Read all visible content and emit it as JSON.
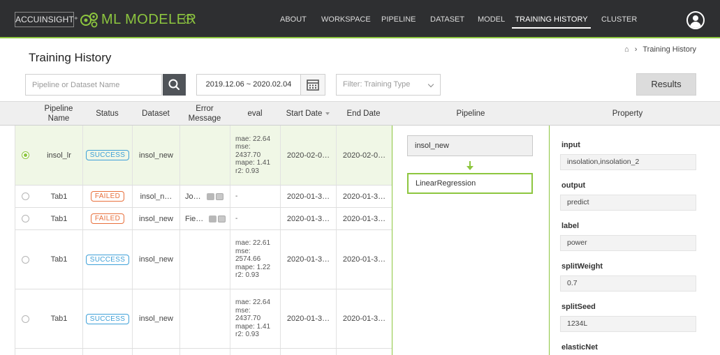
{
  "nav": {
    "brand": "ACCUINSIGHT⁺",
    "product": "ML MODELER",
    "items": [
      "ABOUT",
      "WORKSPACE",
      "PIPELINE",
      "DATASET",
      "MODEL",
      "TRAINING HISTORY",
      "CLUSTER"
    ],
    "active": "TRAINING HISTORY",
    "accent_color": "#8dc63f"
  },
  "page": {
    "title": "Training History",
    "breadcrumb": "Training History"
  },
  "filters": {
    "search_placeholder": "Pipeline or Dataset Name",
    "date_range": "2019.12.06 ~ 2020.02.04",
    "type_placeholder": "Filter: Training Type",
    "results_label": "Results"
  },
  "table": {
    "headers": {
      "pipeline_name": "Pipeline\nName",
      "status": "Status",
      "dataset": "Dataset",
      "error_message": "Error\nMessage",
      "eval": "eval",
      "start_date": "Start Date",
      "end_date": "End Date",
      "pipeline": "Pipeline",
      "property": "Property"
    },
    "rows": [
      {
        "selected": true,
        "name": "insol_lr",
        "status": "SUCCESS",
        "dataset": "insol_new",
        "error": "",
        "eval": [
          "mae: 22.64",
          "mse:",
          "2437.70",
          "mape: 1.41",
          "r2: 0.93"
        ],
        "start": "2020-02-0…",
        "end": "2020-02-0…"
      },
      {
        "selected": false,
        "name": "Tab1",
        "status": "FAILED",
        "dataset": "insol_n…",
        "error": "Jo…",
        "eval": [
          "-"
        ],
        "start": "2020-01-3…",
        "end": "2020-01-3…"
      },
      {
        "selected": false,
        "name": "Tab1",
        "status": "FAILED",
        "dataset": "insol_new",
        "error": "Fie…",
        "eval": [
          "-"
        ],
        "start": "2020-01-3…",
        "end": "2020-01-3…"
      },
      {
        "selected": false,
        "name": "Tab1",
        "status": "SUCCESS",
        "dataset": "insol_new",
        "error": "",
        "eval": [
          "mae: 22.61",
          "mse:",
          "2574.66",
          "mape: 1.22",
          "r2: 0.93"
        ],
        "start": "2020-01-3…",
        "end": "2020-01-3…"
      },
      {
        "selected": false,
        "name": "Tab1",
        "status": "SUCCESS",
        "dataset": "insol_new",
        "error": "",
        "eval": [
          "mae: 22.64",
          "mse:",
          "2437.70",
          "mape: 1.41",
          "r2: 0.93"
        ],
        "start": "2020-01-3…",
        "end": "2020-01-3…"
      }
    ]
  },
  "pipeline": {
    "nodes": [
      "insol_new",
      "LinearRegression"
    ]
  },
  "properties": [
    {
      "label": "input",
      "value": "insolation,insolation_2"
    },
    {
      "label": "output",
      "value": "predict"
    },
    {
      "label": "label",
      "value": "power"
    },
    {
      "label": "splitWeight",
      "value": "0.7"
    },
    {
      "label": "splitSeed",
      "value": "1234L"
    },
    {
      "label": "elasticNet",
      "value": ""
    }
  ]
}
